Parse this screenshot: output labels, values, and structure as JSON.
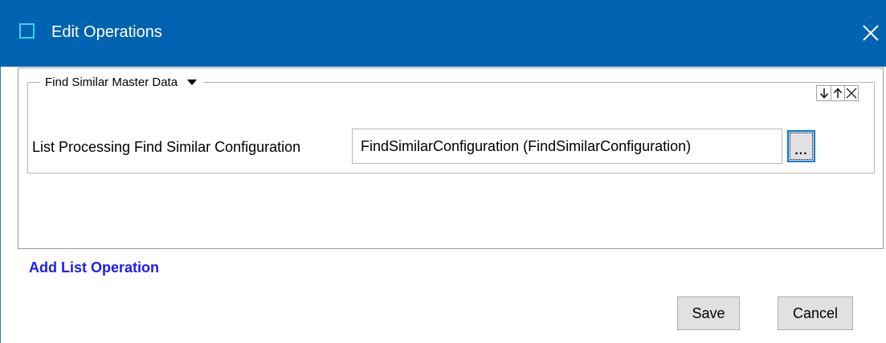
{
  "window": {
    "title": "Edit Operations",
    "title_bar_color": "#0063b1",
    "icons": {
      "app": "window-icon",
      "close": "close-icon"
    }
  },
  "operation_group": {
    "title": "Find Similar Master Data",
    "dropdown_icon": "triangle-down-icon",
    "controls": [
      "move-down-icon",
      "move-up-icon",
      "remove-icon"
    ]
  },
  "field": {
    "label": "List Processing Find Similar Configuration",
    "value": "FindSimilarConfiguration (FindSimilarConfiguration)",
    "browse_label": "..."
  },
  "add_link": {
    "label": "Add List Operation",
    "color": "#1a1aff"
  },
  "buttons": {
    "save": "Save",
    "cancel": "Cancel"
  }
}
